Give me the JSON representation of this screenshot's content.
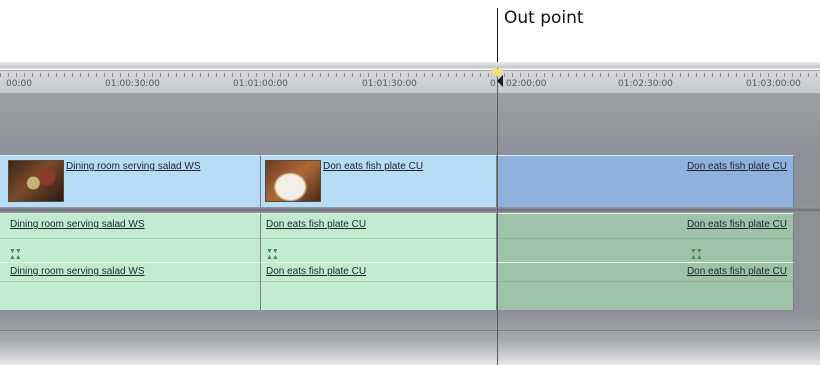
{
  "callout": {
    "label": "Out point"
  },
  "ruler": {
    "timecodes": [
      "00:00",
      "01:00:30:00",
      "01:01:00:00",
      "01:01:30:00",
      "0",
      "02:00:00",
      "01:02:30:00",
      "01:03:00:00"
    ]
  },
  "tracks": {
    "video": [
      {
        "name": "Dining room serving salad WS",
        "thumbnail": "dining-room-thumbnail"
      },
      {
        "name": "Don eats fish plate CU",
        "thumbnail": "fish-plate-thumbnail"
      },
      {
        "name": "Don eats fish plate CU"
      }
    ],
    "audio1": [
      {
        "name": "Dining room serving salad WS"
      },
      {
        "name": "Don eats fish plate CU"
      },
      {
        "name": "Don eats fish plate CU"
      }
    ],
    "audio2": [
      {
        "name": "Dining room serving salad WS"
      },
      {
        "name": "Don eats fish plate CU"
      },
      {
        "name": "Don eats fish plate CU"
      }
    ]
  },
  "colors": {
    "video_clip": "#b7dcf6",
    "video_clip_after_out": "#8fb2dc",
    "audio_clip": "#c1ebcf",
    "audio_clip_after_out": "#9fc3a9",
    "out_point_marker": "#f2e26a",
    "track_background": "#8e9099"
  }
}
